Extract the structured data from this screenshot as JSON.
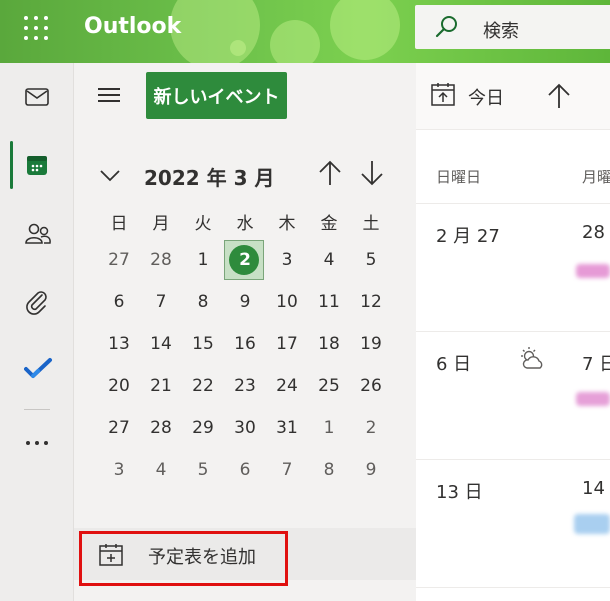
{
  "header": {
    "app_title": "Outlook",
    "search_placeholder": "検索",
    "colors": {
      "brand": "#5fb43e"
    }
  },
  "rail": {
    "items": [
      {
        "name": "mail",
        "icon": "mail-icon",
        "active": false
      },
      {
        "name": "calendar",
        "icon": "calendar-icon",
        "active": true
      },
      {
        "name": "people",
        "icon": "people-icon",
        "active": false
      },
      {
        "name": "files",
        "icon": "paperclip-icon",
        "active": false
      },
      {
        "name": "todo",
        "icon": "todo-check-icon",
        "active": false
      },
      {
        "name": "more",
        "icon": "more-icon",
        "active": false
      }
    ]
  },
  "nav": {
    "new_event_label": "新しいイベント",
    "month_label": "2022 年 3 月",
    "weekdays": [
      "日",
      "月",
      "火",
      "水",
      "木",
      "金",
      "土"
    ],
    "weeks": [
      [
        {
          "d": "27",
          "o": true
        },
        {
          "d": "28",
          "o": true
        },
        {
          "d": "1"
        },
        {
          "d": "2",
          "today": true
        },
        {
          "d": "3"
        },
        {
          "d": "4"
        },
        {
          "d": "5"
        }
      ],
      [
        {
          "d": "6"
        },
        {
          "d": "7"
        },
        {
          "d": "8"
        },
        {
          "d": "9"
        },
        {
          "d": "10"
        },
        {
          "d": "11"
        },
        {
          "d": "12"
        }
      ],
      [
        {
          "d": "13"
        },
        {
          "d": "14"
        },
        {
          "d": "15"
        },
        {
          "d": "16"
        },
        {
          "d": "17"
        },
        {
          "d": "18"
        },
        {
          "d": "19"
        }
      ],
      [
        {
          "d": "20"
        },
        {
          "d": "21"
        },
        {
          "d": "22"
        },
        {
          "d": "23"
        },
        {
          "d": "24"
        },
        {
          "d": "25"
        },
        {
          "d": "26"
        }
      ],
      [
        {
          "d": "27"
        },
        {
          "d": "28"
        },
        {
          "d": "29"
        },
        {
          "d": "30"
        },
        {
          "d": "31"
        },
        {
          "d": "1",
          "o": true
        },
        {
          "d": "2",
          "o": true
        }
      ],
      [
        {
          "d": "3",
          "o": true
        },
        {
          "d": "4",
          "o": true
        },
        {
          "d": "5",
          "o": true
        },
        {
          "d": "6",
          "o": true
        },
        {
          "d": "7",
          "o": true
        },
        {
          "d": "8",
          "o": true
        },
        {
          "d": "9",
          "o": true
        }
      ]
    ],
    "add_calendar_label": "予定表を追加"
  },
  "main": {
    "today_label": "今日",
    "day_headers": [
      "日曜日",
      "月曜"
    ],
    "rows": [
      {
        "col1": "2 月 27",
        "col2": "28"
      },
      {
        "col1": "6 日",
        "col2": "7 日",
        "weather": "partly-cloudy-icon"
      },
      {
        "col1": "13 日",
        "col2": "14"
      }
    ]
  }
}
